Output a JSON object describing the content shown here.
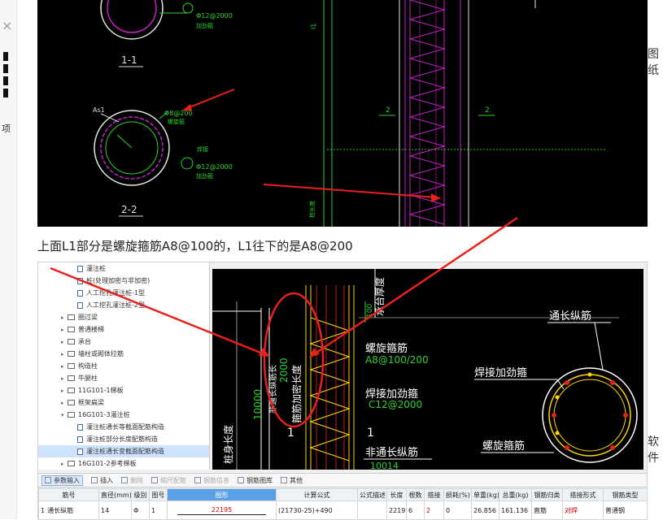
{
  "left_panel": {
    "close_glyph": "×",
    "small_label": "项"
  },
  "top_drawing": {
    "section_1": "1-1",
    "section_2": "2-2",
    "label_a": "As1",
    "rebar_top_1": "Φ12@2000",
    "rebar_top_2": "加劲箍",
    "rebar_mid_1": "Φ8@200",
    "rebar_mid_2": "螺旋箍",
    "rebar_low_1": "焊接",
    "rebar_low_2": "Φ12@2000",
    "rebar_low_3": "加劲箍",
    "dim_2a": "2",
    "dim_2b": "2",
    "dim_1": "l1",
    "side_label": "桩长度"
  },
  "side_texts": {
    "right_top": "图纸",
    "right_bottom": "软件"
  },
  "caption": "上面L1部分是螺旋箍筋A8@100的，L1往下的是A8@200",
  "tree": {
    "items": [
      {
        "label": "灌注桩",
        "type": "doc",
        "indent": 2
      },
      {
        "label": "桩(处理加密与非加密)",
        "type": "doc",
        "indent": 2
      },
      {
        "label": "人工挖孔灌注桩-1型",
        "type": "doc",
        "indent": 2
      },
      {
        "label": "人工挖孔灌注桩-2型",
        "type": "doc",
        "indent": 2
      },
      {
        "label": "圈过梁",
        "type": "folder",
        "indent": 1
      },
      {
        "label": "普通楼梯",
        "type": "folder",
        "indent": 1
      },
      {
        "label": "承台",
        "type": "folder",
        "indent": 1
      },
      {
        "label": "墙柱或砌体拉筋",
        "type": "folder",
        "indent": 1
      },
      {
        "label": "构造柱",
        "type": "folder",
        "indent": 1
      },
      {
        "label": "牛腿柱",
        "type": "folder",
        "indent": 1
      },
      {
        "label": "11G101-1梯板",
        "type": "folder",
        "indent": 1
      },
      {
        "label": "框架扁梁",
        "type": "folder",
        "indent": 1
      },
      {
        "label": "16G101-3灌注桩",
        "type": "folder-open",
        "indent": 1
      },
      {
        "label": "灌注桩通长等截面配筋构造",
        "type": "doc",
        "indent": 2
      },
      {
        "label": "灌注桩部分长度配筋构造",
        "type": "doc",
        "indent": 2
      },
      {
        "label": "灌注桩通长变截面配筋构造",
        "type": "doc",
        "indent": 2,
        "selected": true
      },
      {
        "label": "16G101-2参考梯板",
        "type": "folder",
        "indent": 1
      }
    ]
  },
  "drawing2": {
    "spiral_label": "螺旋箍筋",
    "spiral_value": "A8@100/200",
    "stiff_label": "焊接加劲箍",
    "stiff_value": "C12@2000",
    "nonlong_label": "非通长纵筋",
    "long_label": "通长纵筋",
    "weld_label": "焊接加劲箍",
    "spiral_label2": "螺旋箍筋",
    "dense_label": "箍筋加密长度",
    "dense_value": "2000",
    "nonlong_len_label": "非通长纵筋长",
    "nonlong_len_value": "10000",
    "pile_len": "桩身长度",
    "cap_label": "承台厚度",
    "mark_1": "1",
    "mark_1b": "1"
  },
  "toolbar": {
    "items": [
      {
        "label": "参数输入",
        "state": "active"
      },
      {
        "label": "插入",
        "state": "normal"
      },
      {
        "label": "删除",
        "state": "disabled"
      },
      {
        "label": "缩尺配筋",
        "state": "disabled"
      },
      {
        "label": "钢筋信息",
        "state": "disabled"
      },
      {
        "label": "钢筋图库",
        "state": "normal"
      },
      {
        "label": "其他",
        "state": "normal"
      }
    ]
  },
  "table": {
    "headers": [
      "筋号",
      "直径(mm)",
      "级别",
      "图号",
      "图形",
      "计算公式",
      "公式描述",
      "长度",
      "根数",
      "搭接",
      "损耗(%)",
      "单重(kg)",
      "总重(kg)",
      "钢筋归类",
      "搭接形式",
      "钢筋类型"
    ],
    "rows": [
      {
        "index": "1",
        "cells": [
          "通长纵筋",
          "14",
          "Φ",
          "1",
          "22195",
          "(21730-25)+490",
          "",
          "22195",
          "6",
          "2",
          "0",
          "26.856",
          "161.136",
          "直筋",
          "对焊",
          "普通钢"
        ]
      }
    ]
  },
  "colors": {
    "annotation_arrow": "#e8211d",
    "spiral": "#c81ec8",
    "highlight_header": "#5aa0e6"
  }
}
